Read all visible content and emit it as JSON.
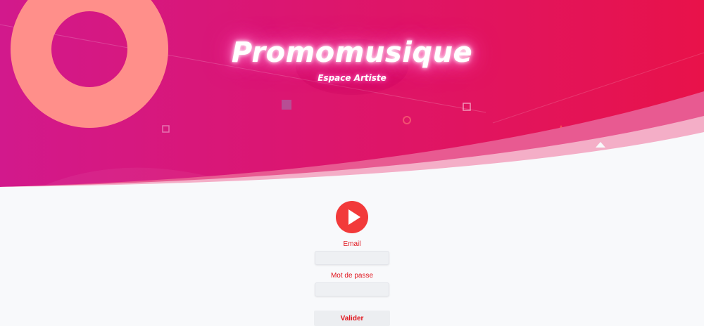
{
  "brand": {
    "title": "Promomusique",
    "subtitle": "Espace Artiste"
  },
  "login": {
    "play_icon": "play-icon",
    "email_label": "Email",
    "email_value": "",
    "password_label": "Mot de passe",
    "password_value": "",
    "submit_label": "Valider"
  },
  "colors": {
    "hero_start": "#d2198c",
    "hero_end": "#e8124a",
    "ring": "#ff8f8a",
    "accent_red": "#e0141c",
    "play_button": "#f23a3a",
    "page_background": "#f8f9fb"
  }
}
